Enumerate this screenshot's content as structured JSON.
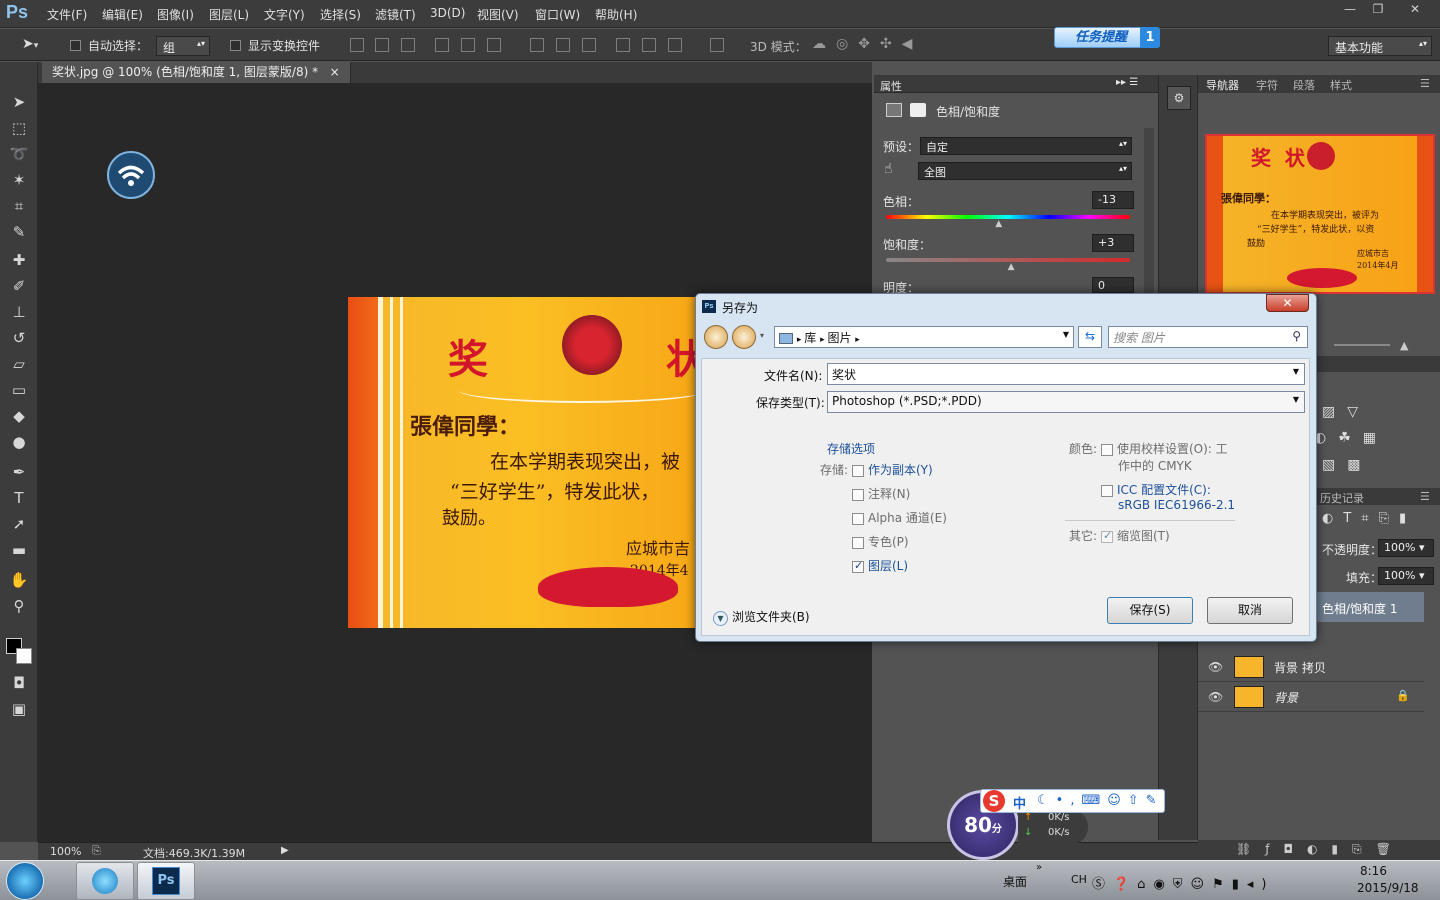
{
  "app": {
    "logo": "Ps"
  },
  "menu": [
    "文件(F)",
    "编辑(E)",
    "图像(I)",
    "图层(L)",
    "文字(Y)",
    "选择(S)",
    "滤镜(T)",
    "3D(D)",
    "视图(V)",
    "窗口(W)",
    "帮助(H)"
  ],
  "window_controls": {
    "minimize": "—",
    "restore": "❐",
    "close": "✕"
  },
  "options": {
    "auto_select_label": "自动选择：",
    "auto_select_value": "组",
    "show_transform_label": "显示变换控件",
    "mode_3d_label": "3D 模式：",
    "workspace": "基本功能"
  },
  "task_reminder": {
    "label": "任务提醒",
    "count": "1"
  },
  "document": {
    "tab_title": "奖状.jpg @ 100% (色相/饱和度 1, 图层蒙版/8) *",
    "tab_close": "×",
    "zoom": "100%",
    "doc_size": "文档:469.3K/1.39M"
  },
  "certificate": {
    "title_left": "奖",
    "title_right": "状",
    "recipient": "張偉同學：",
    "line1": "在本学期表现突出，被",
    "line2": "“三好学生”，特发此状，",
    "line3": "鼓励。",
    "issuer": "应城市吉",
    "date": "2014年4"
  },
  "properties_panel": {
    "tab": "属性",
    "title": "色相/饱和度",
    "preset_label": "预设：",
    "preset_value": "自定",
    "channel_value": "全图",
    "hue_label": "色相：",
    "hue_value": "-13",
    "sat_label": "饱和度：",
    "sat_value": "+3",
    "light_label": "明度：",
    "light_value": "0",
    "hue": -13,
    "saturation": 3
  },
  "nav_tabs": [
    "导航器",
    "字符",
    "段落",
    "样式"
  ],
  "nav_thumb": {
    "title": "奖  状",
    "recipient": "張偉同學：",
    "line1": "在本学期表现突出，被评为",
    "line2": "“三好学生”，特发此状，以资",
    "line3": "鼓励",
    "issuer": "应城市吉",
    "date": "2014年4月"
  },
  "history_tab": "历史记录",
  "layers": {
    "opacity_label": "不透明度：",
    "opacity_value": "100%",
    "fill_label": "填充：",
    "fill_value": "100%",
    "items": [
      {
        "name": "色相/饱和度 1",
        "selected": true
      },
      {
        "name": "背景 拷贝"
      },
      {
        "name": "背景",
        "locked": true
      }
    ]
  },
  "dialog": {
    "title": "另存为",
    "path": [
      "库",
      "图片"
    ],
    "search_placeholder": "搜索 图片",
    "filename_label": "文件名(N):",
    "filename_value": "奖状",
    "filetype_label": "保存类型(T):",
    "filetype_value": "Photoshop (*.PSD;*.PDD)",
    "save_options_label": "存储选项",
    "save_label": "存储:",
    "as_copy": "作为副本(Y)",
    "notes": "注释(N)",
    "alpha": "Alpha 通道(E)",
    "spot": "专色(P)",
    "layers": "图层(L)",
    "color_label": "颜色:",
    "proof_setup": "使用校样设置(O): 工",
    "proof_setup_2": "作中的 CMYK",
    "icc_profile": "ICC 配置文件(C):",
    "icc_value": "sRGB IEC61966-2.1",
    "other_label": "其它:",
    "thumbnail": "缩览图(T)",
    "browse_folders": "浏览文件夹(B)",
    "save_button": "保存(S)",
    "cancel_button": "取消"
  },
  "sogou": {
    "speed_score": "80",
    "speed_unit": "分",
    "up": "0K/s",
    "down": "0K/s",
    "ime_lang": "中"
  },
  "taskbar": {
    "desktop": "桌面",
    "lang": "CH",
    "time": "8:16",
    "date": "2015/9/18"
  },
  "colors": {
    "accent": "#1d4f9a",
    "ps_blue": "#8fc4ef",
    "cert_orange": "#fbbf24",
    "cert_red": "#d2152a"
  }
}
